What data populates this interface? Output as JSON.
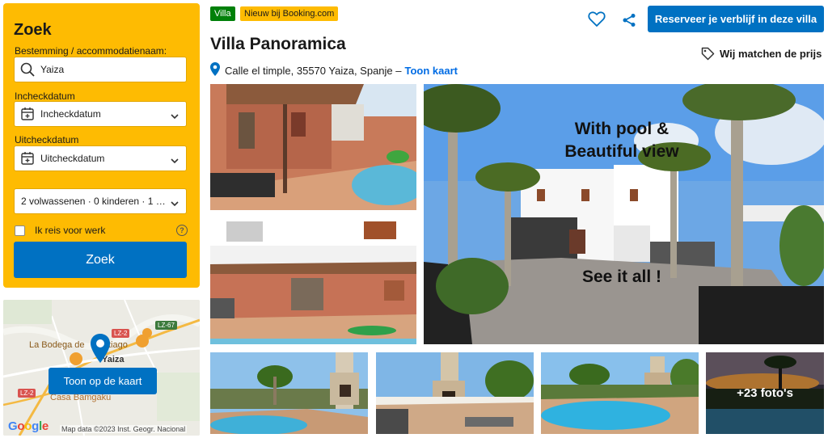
{
  "search": {
    "title": "Zoek",
    "destination_label": "Bestemming / accommodatienaam:",
    "destination_value": "Yaiza",
    "checkin_label": "Incheckdatum",
    "checkin_value": "Incheckdatum",
    "checkout_label": "Uitcheckdatum",
    "checkout_value": "Uitcheckdatum",
    "guests_value": "2 volwassenen · 0 kinderen · 1 …",
    "work_travel_label": "Ik reis voor werk",
    "help_glyph": "?",
    "search_button": "Zoek"
  },
  "map": {
    "place_labels": [
      "La Bodega de",
      "tiago",
      "Yaiza",
      "Casa Bamgaku"
    ],
    "road_labels": [
      "LZ-2",
      "LZ-67",
      "LZ-2"
    ],
    "show_on_map_button": "Toon op de kaart",
    "google_logo": "Google",
    "credit": "Map data ©2023 Inst. Geogr. Nacional"
  },
  "header": {
    "type_badge": "Villa",
    "new_badge": "Nieuw bij Booking.com",
    "title": "Villa Panoramica",
    "address": "Calle el timple, 35570 Yaiza, Spanje –",
    "map_link": "Toon kaart",
    "reserve_button": "Reserveer je verblijf in deze villa",
    "price_match": "Wij matchen de prijs"
  },
  "gallery": {
    "main_overlay_line1": "With pool &",
    "main_overlay_line2": "Beautiful view",
    "main_overlay_line3": "See it all !",
    "more_photos": "+23 foto's"
  },
  "colors": {
    "brand_blue": "#0071c2",
    "brand_yellow": "#febb02",
    "link_blue": "#006ce4",
    "green_badge": "#008009"
  },
  "icons": [
    "search-icon",
    "calendar-icon",
    "chevron-down-icon",
    "help-icon",
    "map-pin-icon",
    "heart-icon",
    "share-icon",
    "price-tag-icon"
  ]
}
